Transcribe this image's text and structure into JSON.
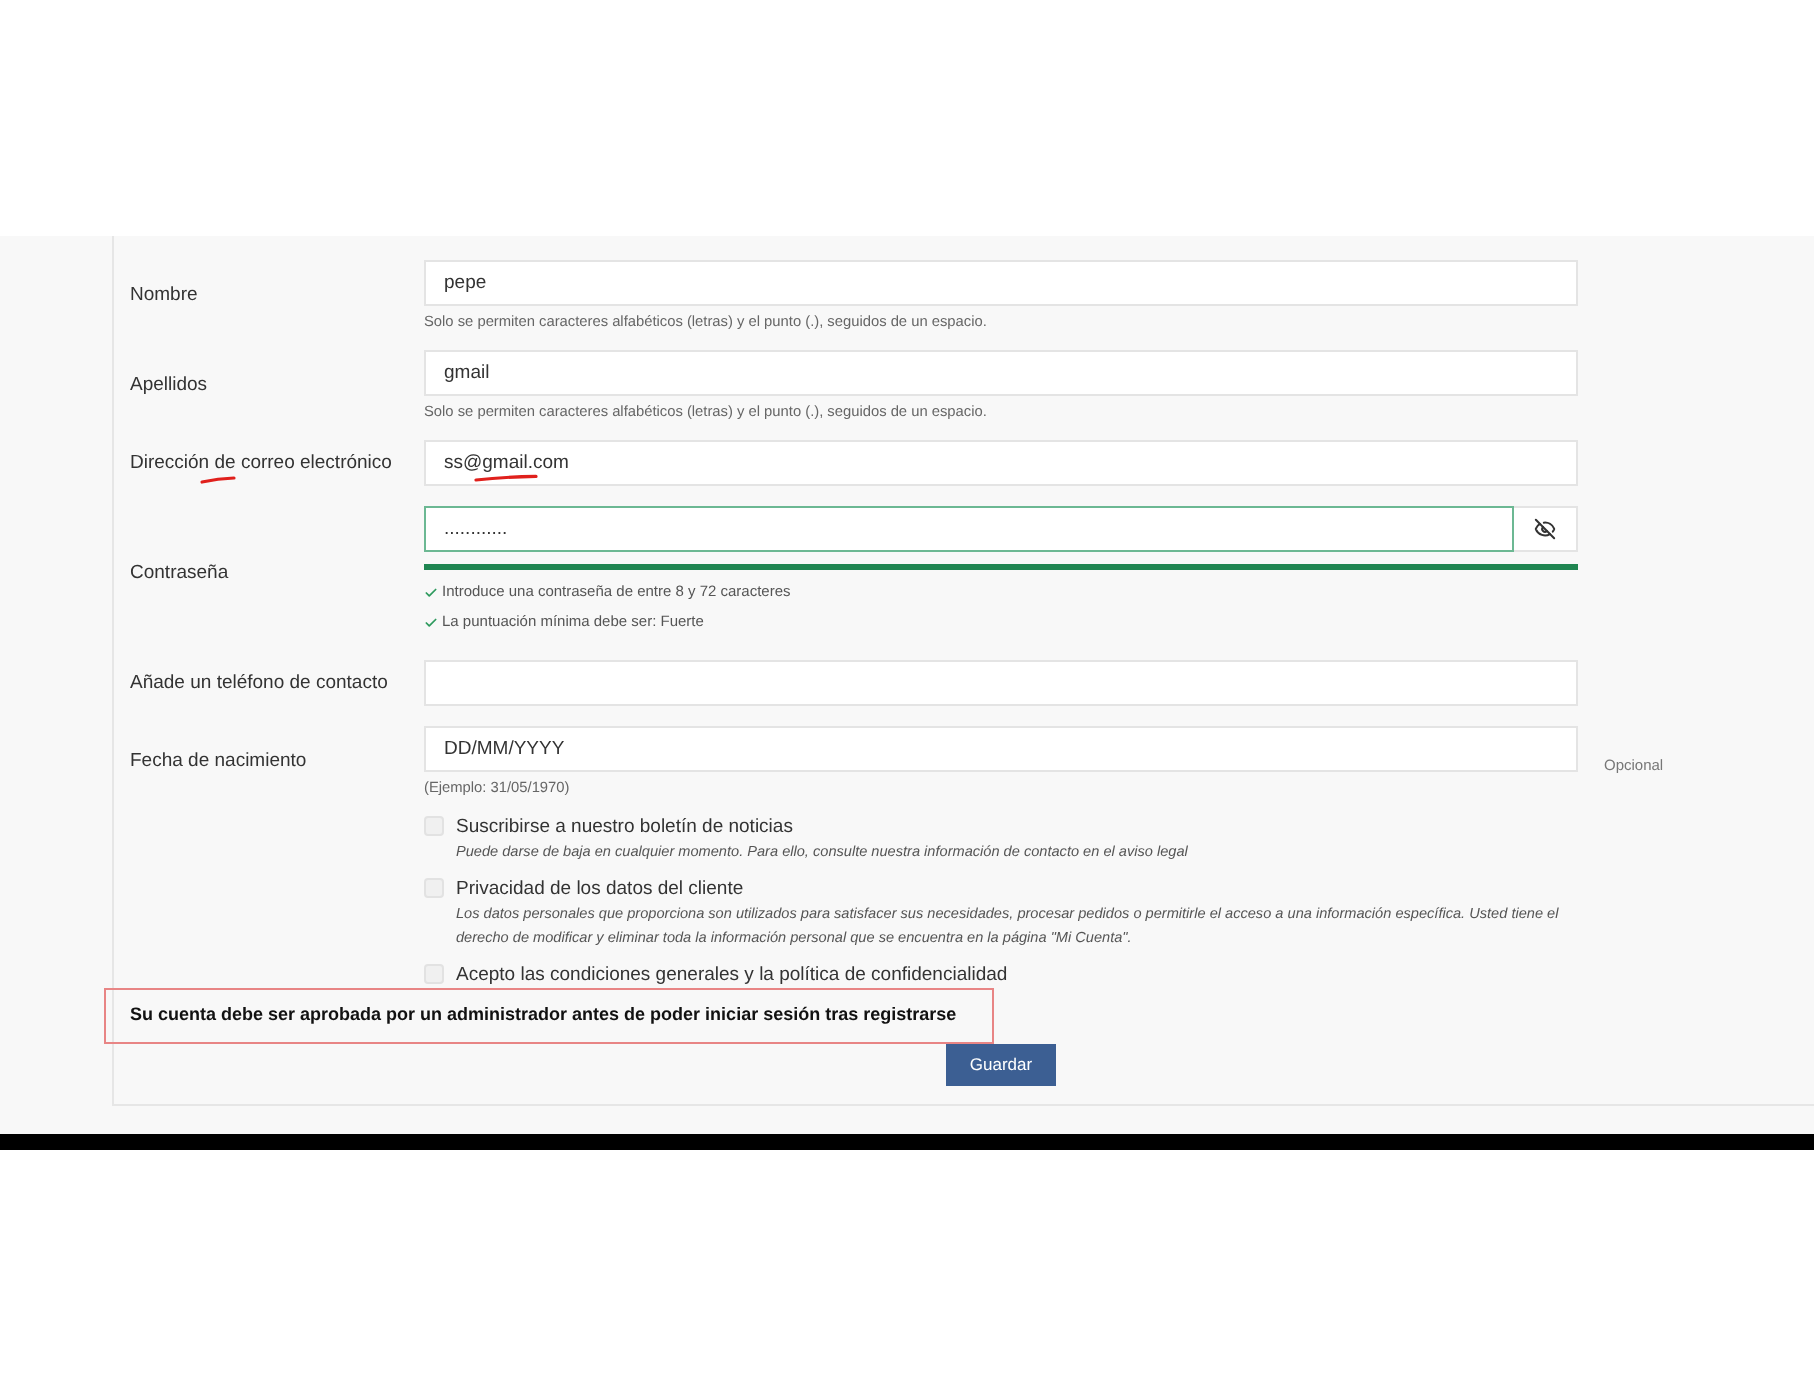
{
  "form": {
    "fields": [
      {
        "kind": "text",
        "label": "Nombre",
        "value": "pepe",
        "hint": "Solo se permiten caracteres alfabéticos (letras) y el punto (.), seguidos de un espacio."
      },
      {
        "kind": "text",
        "label": "Apellidos",
        "value": "gmail",
        "hint": "Solo se permiten caracteres alfabéticos (letras) y el punto (.), seguidos de un espacio."
      },
      {
        "kind": "email",
        "label": "Dirección de correo electrónico",
        "value": "ss@gmail.com",
        "annotated": true
      },
      {
        "kind": "password",
        "label": "Contraseña",
        "value": "............",
        "focused": true,
        "strength": {
          "level": 1
        },
        "rules": [
          {
            "text": "Introduce una contraseña de entre 8 y 72 caracteres",
            "met": true
          },
          {
            "text": "La puntuación mínima debe ser: Fuerte",
            "met": true
          }
        ]
      },
      {
        "kind": "tel",
        "label": "Añade un teléfono de contacto"
      },
      {
        "kind": "date",
        "label": "Fecha de nacimiento",
        "placeholder": "DD/MM/YYYY",
        "hint": "(Ejemplo: 31/05/1970)",
        "note": "Opcional"
      }
    ],
    "checkboxes": [
      {
        "label": "Suscribirse a nuestro boletín de noticias",
        "description": "Puede darse de baja en cualquier momento. Para ello, consulte nuestra información de contacto en el aviso legal",
        "checked": false
      },
      {
        "label": "Privacidad de los datos del cliente",
        "description": "Los datos personales que proporciona son utilizados para satisfacer sus necesidades, procesar pedidos o permitirle el acceso a una información específica. Usted tiene el derecho de modificar y eliminar toda la información personal que se encuentra en la página \"Mi Cuenta\".",
        "checked": false
      },
      {
        "label": "Acepto las condiciones generales y la política de confidencialidad",
        "checked": false
      }
    ],
    "notice": {
      "text": "Su cuenta debe ser aprobada por un administrador antes de poder iniciar sesión tras registrarse",
      "framed": true
    },
    "submit": "Guardar"
  }
}
